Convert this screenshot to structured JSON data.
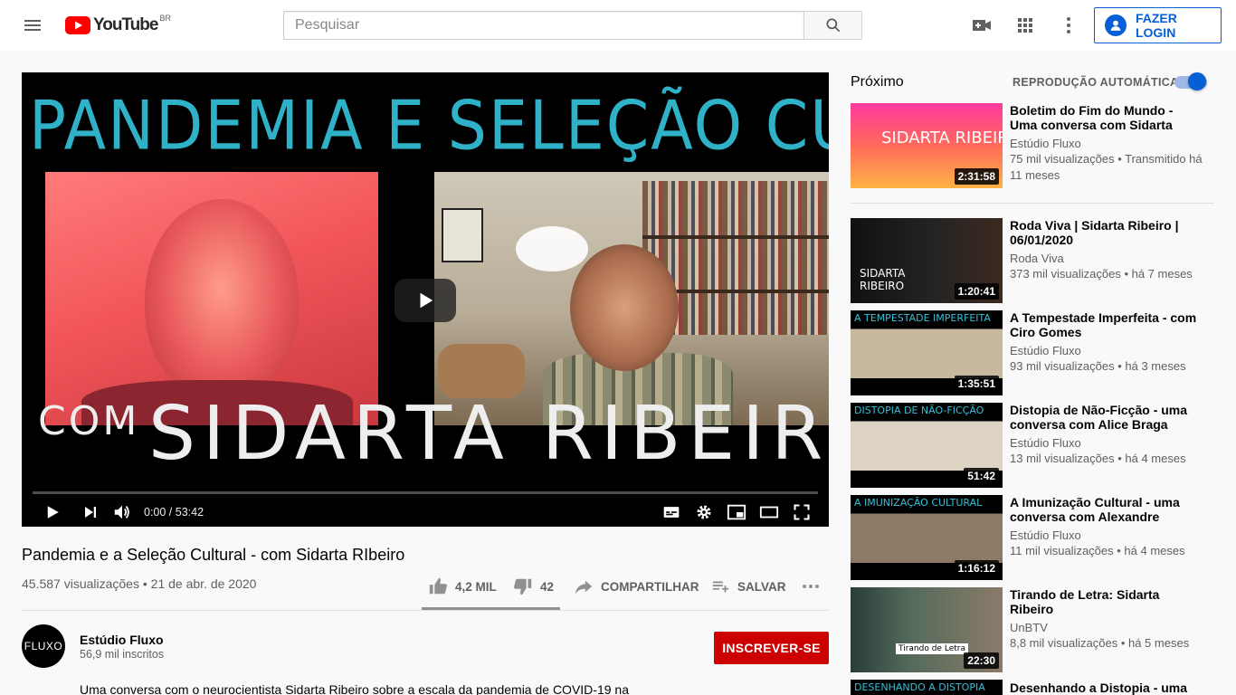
{
  "header": {
    "logo_text": "YouTube",
    "region": "BR",
    "search_placeholder": "Pesquisar",
    "login_label": "FAZER LOGIN"
  },
  "player": {
    "thumbnail_title": "PANDEMIA E SELEÇÃO CULTURAL",
    "thumbnail_com": "COM",
    "thumbnail_name": "SIDARTA RIBEIRO",
    "time_display": "0:00 / 53:42",
    "progress": 0
  },
  "video": {
    "title": "Pandemia e a Seleção Cultural - com Sidarta RIbeiro",
    "meta": "45.587 visualizações • 21 de abr. de 2020",
    "likes": "4,2 MIL",
    "dislikes": "42",
    "share_label": "COMPARTILHAR",
    "save_label": "SALVAR"
  },
  "channel": {
    "avatar_text": "FLUXO",
    "name": "Estúdio Fluxo",
    "subs": "56,9 mil inscritos",
    "subscribe_label": "INSCREVER-SE",
    "description": "Uma conversa com o neurocientista Sidarta Ribeiro sobre a escala da pandemia de COVID-19 na"
  },
  "sidebar": {
    "next_label": "Próximo",
    "autoplay_label": "REPRODUÇÃO AUTOMÁTICA",
    "items": [
      {
        "title": "Boletim do Fim do Mundo - Uma conversa com Sidarta Ribeiro....",
        "channel": "Estúdio Fluxo",
        "meta": "75 mil visualizações • Transmitido há 11 meses",
        "duration": "2:31:58",
        "overlay": "SIDARTA RIBEIRO"
      },
      {
        "title": "Roda Viva | Sidarta Ribeiro | 06/01/2020",
        "channel": "Roda Viva",
        "meta": "373 mil visualizações • há 7 meses",
        "duration": "1:20:41",
        "overlay": "SIDARTA RIBEIRO"
      },
      {
        "title": "A Tempestade Imperfeita - com Ciro Gomes",
        "channel": "Estúdio Fluxo",
        "meta": "93 mil visualizações • há 3 meses",
        "duration": "1:35:51",
        "overlay": "A TEMPESTADE IMPERFEITA"
      },
      {
        "title": "Distopia de Não-Ficção - uma conversa com Alice Braga",
        "channel": "Estúdio Fluxo",
        "meta": "13 mil visualizações • há 4 meses",
        "duration": "51:42",
        "overlay": "DISTOPIA DE NÃO-FICÇÃO"
      },
      {
        "title": "A Imunização Cultural - uma conversa com Alexandre Matias",
        "channel": "Estúdio Fluxo",
        "meta": "11 mil visualizações • há 4 meses",
        "duration": "1:16:12",
        "overlay": "A IMUNIZAÇÃO CULTURAL"
      },
      {
        "title": "Tirando de Letra: Sidarta Ribeiro",
        "channel": "UnBTV",
        "meta": "8,8 mil visualizações • há 5 meses",
        "duration": "22:30",
        "overlay": "Tirando de Letra"
      },
      {
        "title": "Desenhando a Distopia - uma",
        "channel": "",
        "meta": "",
        "duration": "",
        "overlay": "DESENHANDO A DISTOPIA"
      }
    ]
  }
}
